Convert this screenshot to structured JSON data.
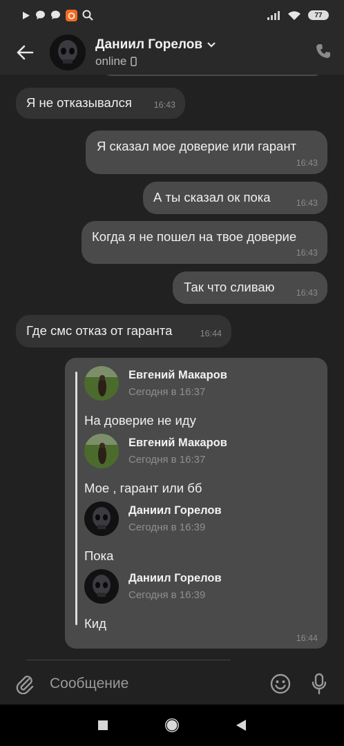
{
  "status_bar": {
    "battery": "77",
    "icons": [
      "play-icon",
      "chat-bubble-icon",
      "chat-bubble-icon",
      "app-notification-icon",
      "search-icon",
      "signal-icon",
      "wifi-icon",
      "battery-icon"
    ]
  },
  "header": {
    "name": "Даниил Горелов",
    "status": "online",
    "icons": [
      "back-arrow-icon",
      "chevron-down-icon",
      "mobile-icon",
      "phone-icon"
    ]
  },
  "messages": [
    {
      "dir": "in",
      "text": "Я не отказывался",
      "time": "16:43"
    },
    {
      "dir": "out",
      "text": "Я сказал мое доверие или гарант",
      "time": "16:43"
    },
    {
      "dir": "out",
      "text": "А ты сказал ок пока",
      "time": "16:43"
    },
    {
      "dir": "out",
      "text": "Когда я не пошел на твое доверие",
      "time": "16:43"
    },
    {
      "dir": "out",
      "text": "Так что сливаю",
      "time": "16:43"
    },
    {
      "dir": "in",
      "text": "Где смс отказ от гаранта",
      "time": "16:44"
    }
  ],
  "forwarded": {
    "time": "16:44",
    "items": [
      {
        "name": "Евгений Макаров",
        "date": "Сегодня в 16:37",
        "text": "На доверие не иду"
      },
      {
        "name": "Евгений Макаров",
        "date": "Сегодня в 16:37",
        "text": "Мое , гарант или бб"
      },
      {
        "name": "Даниил Горелов",
        "date": "Сегодня в 16:39",
        "text": "Пока"
      },
      {
        "name": "Даниил Горелов",
        "date": "Сегодня в 16:39",
        "text": "Кид"
      }
    ]
  },
  "composer": {
    "placeholder": "Сообщение",
    "icons": [
      "attach-icon",
      "emoji-icon",
      "microphone-icon"
    ]
  },
  "nav": {
    "icons": [
      "recent-apps-icon",
      "home-icon",
      "back-icon"
    ]
  },
  "colors": {
    "background": "#212121",
    "bar": "#292929",
    "incoming_bubble": "#333333",
    "outgoing_bubble": "#4a4a4a"
  }
}
